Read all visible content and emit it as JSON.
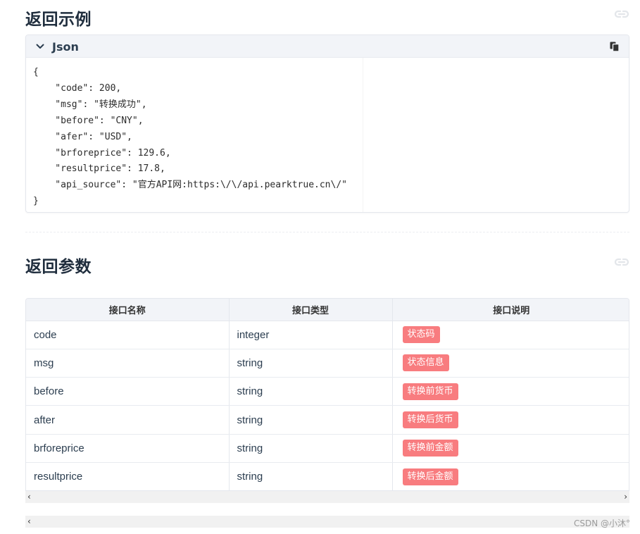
{
  "example_section": {
    "title": "返回示例",
    "anchor_icon": "link-icon"
  },
  "code_block": {
    "language": "Json",
    "collapse_icon": "chevron-down-icon",
    "copy_icon": "copy-icon",
    "content": "{\n    \"code\": 200,\n    \"msg\": \"转换成功\",\n    \"before\": \"CNY\",\n    \"afer\": \"USD\",\n    \"brforeprice\": 129.6,\n    \"resultprice\": 17.8,\n    \"api_source\": \"官方API网:https:\\/\\/api.pearktrue.cn\\/\"\n}"
  },
  "params_section": {
    "title": "返回参数",
    "anchor_icon": "link-icon"
  },
  "params_table": {
    "headers": [
      "接口名称",
      "接口类型",
      "接口说明"
    ],
    "rows": [
      {
        "name": "code",
        "type": "integer",
        "desc": "状态码"
      },
      {
        "name": "msg",
        "type": "string",
        "desc": "状态信息"
      },
      {
        "name": "before",
        "type": "string",
        "desc": "转换前货币"
      },
      {
        "name": "after",
        "type": "string",
        "desc": "转换后货币"
      },
      {
        "name": "brforeprice",
        "type": "string",
        "desc": "转换前金额"
      },
      {
        "name": "resultprice",
        "type": "string",
        "desc": "转换后金额"
      }
    ],
    "badge_color": "#f87c7f"
  },
  "scrollbar": {
    "left_arrow": "‹",
    "right_arrow": "›"
  },
  "watermark": "CSDN @小沐°"
}
